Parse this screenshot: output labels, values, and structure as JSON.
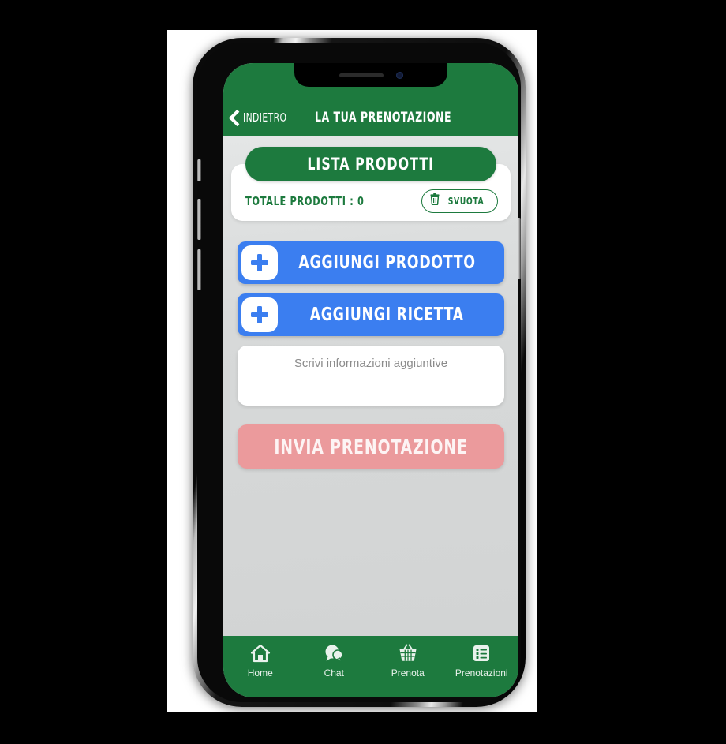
{
  "app": {
    "header": {
      "back_label": "INDIETRO",
      "title": "LA TUA PRENOTAZIONE",
      "back_icon": "chevron-left-icon"
    },
    "products_card": {
      "list_button_label": "LISTA PRODOTTI",
      "total_label": "TOTALE PRODOTTI : 0",
      "clear_button_label": "SVUOTA",
      "clear_button_icon": "trash-icon"
    },
    "actions": [
      {
        "label": "AGGIUNGI PRODOTTO",
        "icon": "plus-icon"
      },
      {
        "label": "AGGIUNGI RICETTA",
        "icon": "plus-icon"
      }
    ],
    "notes": {
      "placeholder": "Scrivi informazioni aggiuntive",
      "value": ""
    },
    "submit": {
      "label": "INVIA PRENOTAZIONE"
    },
    "bottom_nav": [
      {
        "label": "Home",
        "icon": "home-icon"
      },
      {
        "label": "Chat",
        "icon": "chat-bubble-icon"
      },
      {
        "label": "Prenota",
        "icon": "basket-icon"
      },
      {
        "label": "Prenotazioni",
        "icon": "list-icon"
      }
    ]
  },
  "colors": {
    "brand_green": "#1d7a3e",
    "action_blue": "#3b7ef0",
    "submit_salmon": "#eb9a9c",
    "screen_bg": "#d7d9d9",
    "card_white": "#ffffff"
  }
}
